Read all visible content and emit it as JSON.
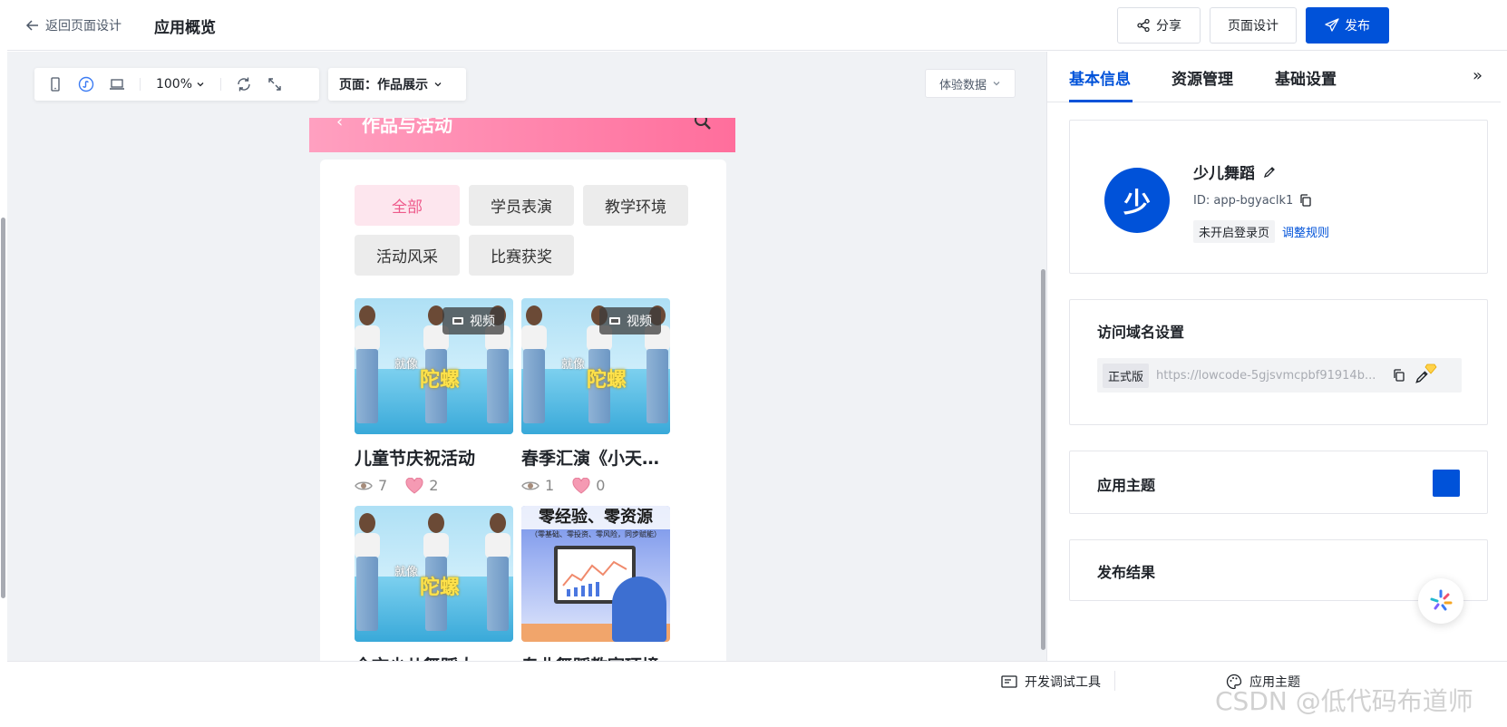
{
  "topbar": {
    "back_label": "返回页面设计",
    "title": "应用概览",
    "share_label": "分享",
    "page_design_label": "页面设计",
    "publish_label": "发布"
  },
  "toolbar": {
    "zoom": "100%",
    "page_select": "页面：作品展示",
    "experience_data": "体验数据"
  },
  "preview": {
    "header_title": "作品与活动",
    "tabs": [
      "全部",
      "学员表演",
      "教学环境",
      "活动风采",
      "比赛获奖"
    ],
    "active_tab": "全部",
    "badge_label": "视频",
    "thumb_text_1": "就像",
    "thumb_text_2": "陀螺",
    "tech_headline": "零经验、零资源",
    "tech_subline": "（零基础、零投资、零风险，同步赋能）",
    "items": [
      {
        "title": "儿童节庆祝活动",
        "views": "7",
        "likes": "2",
        "has_badge": true
      },
      {
        "title": "春季汇演《小天…",
        "views": "1",
        "likes": "0",
        "has_badge": true
      },
      {
        "title": "全市少儿舞蹈大…",
        "views": "",
        "likes": "",
        "has_badge": false
      },
      {
        "title": "专业舞蹈教室环境",
        "views": "",
        "likes": "",
        "has_badge": false
      }
    ]
  },
  "right_panel": {
    "tabs": [
      "基本信息",
      "资源管理",
      "基础设置"
    ],
    "active_tab": "基本信息",
    "app": {
      "avatar_char": "少",
      "name": "少儿舞蹈",
      "id": "ID: app-bgyaclk1",
      "login_status": "未开启登录页",
      "adjust_link": "调整规则"
    },
    "domain": {
      "title": "访问域名设置",
      "tag": "正式版",
      "url": "https://lowcode-5gjsvmcpbf91914b..."
    },
    "theme": {
      "title": "应用主题",
      "color": "#0052d9"
    },
    "publish_result": {
      "title": "发布结果"
    }
  },
  "statusbar": {
    "dev_tools": "开发调试工具",
    "app_theme": "应用主题"
  },
  "watermark": "CSDN @低代码布道师",
  "colors": {
    "brand": "#0052d9",
    "pink_accent": "#ee5a8b"
  }
}
